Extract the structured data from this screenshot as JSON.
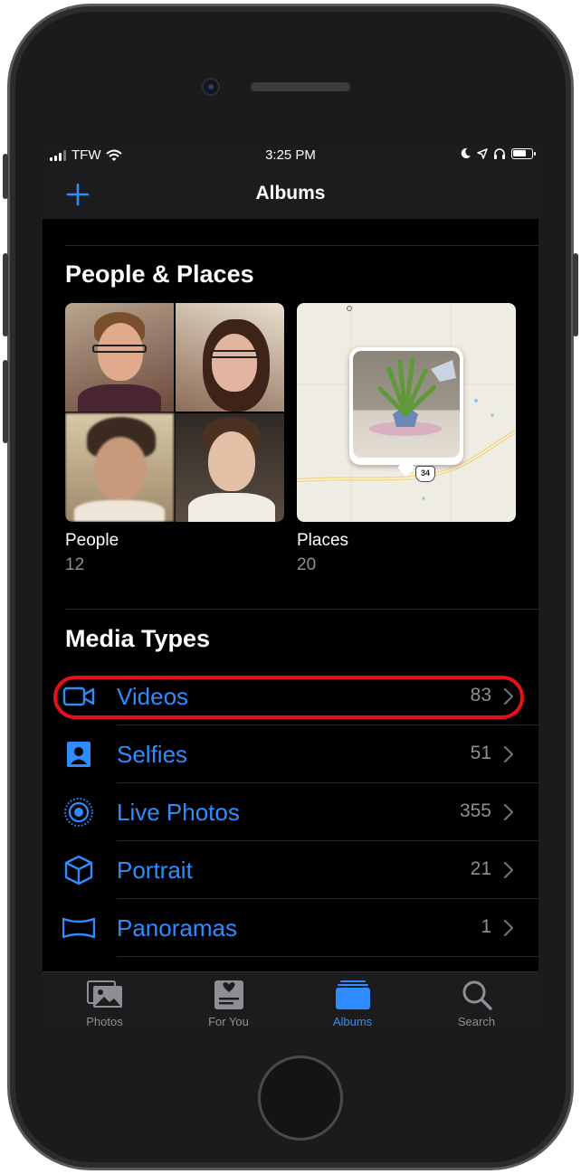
{
  "status_bar": {
    "carrier": "TFW",
    "time": "3:25 PM"
  },
  "nav": {
    "title": "Albums",
    "add_icon": "plus-icon"
  },
  "people_places": {
    "section_title": "People & Places",
    "albums": [
      {
        "label": "People",
        "count": "12"
      },
      {
        "label": "Places",
        "count": "20"
      }
    ],
    "map": {
      "road_marker": "34"
    }
  },
  "media_types": {
    "section_title": "Media Types",
    "items": [
      {
        "label": "Videos",
        "count": "83",
        "icon": "video-camera-icon",
        "highlighted": true
      },
      {
        "label": "Selfies",
        "count": "51",
        "icon": "selfie-portrait-icon"
      },
      {
        "label": "Live Photos",
        "count": "355",
        "icon": "live-photo-icon"
      },
      {
        "label": "Portrait",
        "count": "21",
        "icon": "cube-icon"
      },
      {
        "label": "Panoramas",
        "count": "1",
        "icon": "panorama-icon"
      }
    ]
  },
  "tabbar": {
    "tabs": [
      {
        "label": "Photos",
        "icon": "photos-icon",
        "active": false
      },
      {
        "label": "For You",
        "icon": "for-you-icon",
        "active": false
      },
      {
        "label": "Albums",
        "icon": "albums-icon",
        "active": true
      },
      {
        "label": "Search",
        "icon": "search-icon",
        "active": false
      }
    ]
  },
  "colors": {
    "accent": "#2f8cff",
    "highlight_ring": "#e6101a",
    "background": "#000000",
    "bar_background": "#1c1c1e",
    "secondary_text": "#8e8e93"
  }
}
